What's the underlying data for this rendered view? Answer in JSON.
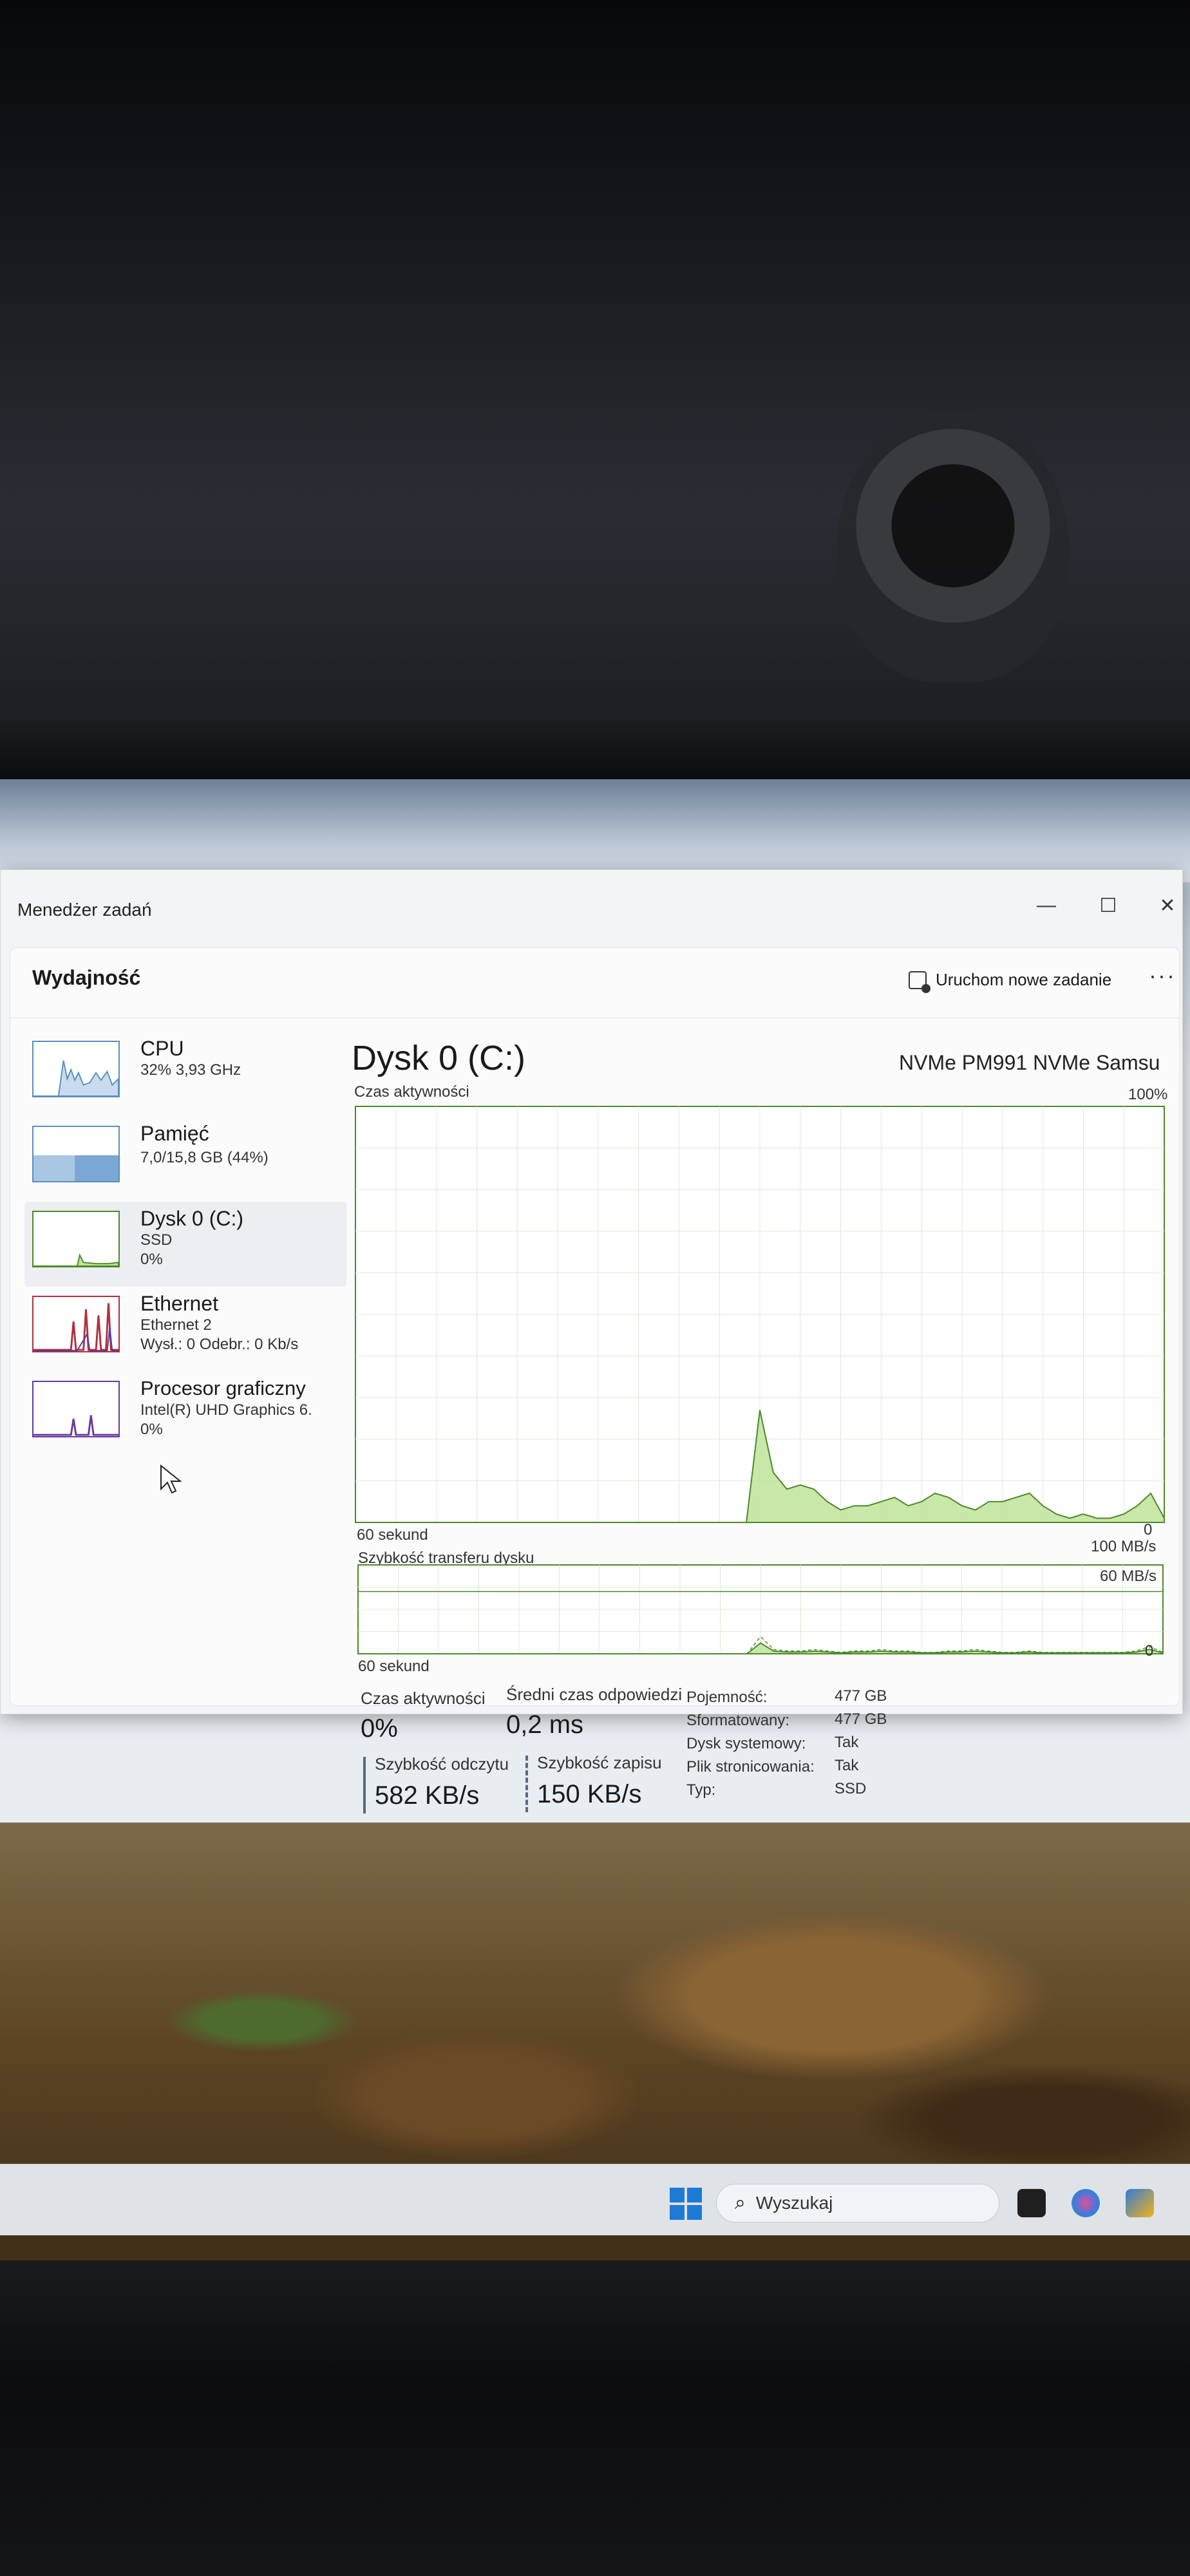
{
  "window": {
    "title": "Menedżer zadań",
    "controls": {
      "minimize": "—",
      "maximize": "☐",
      "close": "✕"
    }
  },
  "header": {
    "page": "Wydajność",
    "run_task_label": "Uruchom nowe zadanie",
    "more_label": "···"
  },
  "sidebar": {
    "items": [
      {
        "name": "CPU",
        "sub1": "32% 3,93 GHz",
        "sub2": "",
        "thumb_color": "#5a8fbf"
      },
      {
        "name": "Pamięć",
        "sub1": "7,0/15,8 GB (44%)",
        "sub2": "",
        "thumb_color": "#5a8fbf"
      },
      {
        "name": "Dysk 0 (C:)",
        "sub1": "SSD",
        "sub2": "0%",
        "thumb_color": "#4a8a2a"
      },
      {
        "name": "Ethernet",
        "sub1": "Ethernet 2",
        "sub2": "Wysł.: 0 Odebr.: 0 Kb/s",
        "thumb_color": "#b03040"
      },
      {
        "name": "Procesor graficzny",
        "sub1": "Intel(R) UHD Graphics 6.",
        "sub2": "0%",
        "thumb_color": "#6a3aa0"
      }
    ]
  },
  "disk": {
    "title": "Dysk 0 (C:)",
    "model": "NVMe PM991 NVMe Samsu",
    "activity_label": "Czas aktywności",
    "activity_max": "100%",
    "time_label_1": "60 sekund",
    "activity_min": "0",
    "transfer_label": "Szybkość transferu dysku",
    "transfer_max": "100 MB/s",
    "transfer_mid": "60 MB/s",
    "time_label_2": "60 sekund",
    "transfer_min": "0"
  },
  "stats": {
    "activity_label": "Czas aktywności",
    "activity_value": "0%",
    "response_label": "Średni czas odpowiedzi",
    "response_value": "0,2 ms",
    "read_label": "Szybkość odczytu",
    "read_value": "582 KB/s",
    "write_label": "Szybkość zapisu",
    "write_value": "150 KB/s"
  },
  "properties": [
    {
      "key": "Pojemność:",
      "value": "477 GB"
    },
    {
      "key": "Sformatowany:",
      "value": "477 GB"
    },
    {
      "key": "Dysk systemowy:",
      "value": "Tak"
    },
    {
      "key": "Plik stronicowania:",
      "value": "Tak"
    },
    {
      "key": "Typ:",
      "value": "SSD"
    }
  ],
  "taskbar": {
    "search_placeholder": "Wyszukaj"
  },
  "colors": {
    "accent_green": "#4a8a2a",
    "green_fill": "#bfe39a",
    "cpu_blue": "#5a8fbf",
    "ethernet_red": "#b03040",
    "gpu_purple": "#6a3aa0"
  },
  "chart_data": [
    {
      "type": "area",
      "title": "Czas aktywności",
      "ylabel": "",
      "ylim": [
        0,
        100
      ],
      "y_unit": "%",
      "x_span_seconds": 60,
      "series": [
        {
          "values": [
            0,
            0,
            0,
            0,
            0,
            0,
            0,
            0,
            0,
            0,
            0,
            0,
            0,
            0,
            0,
            0,
            0,
            0,
            0,
            0,
            0,
            0,
            0,
            0,
            0,
            0,
            0,
            0,
            0,
            0,
            27,
            12,
            8,
            9,
            8,
            5,
            3,
            4,
            4,
            5,
            6,
            4,
            5,
            7,
            6,
            4,
            3,
            5,
            5,
            6,
            7,
            4,
            2,
            1,
            2,
            1,
            1,
            2,
            4,
            7,
            1
          ]
        }
      ]
    },
    {
      "type": "area",
      "title": "Szybkość transferu dysku",
      "ylabel": "",
      "ylim": [
        0,
        100
      ],
      "y_unit": "MB/s",
      "x_span_seconds": 60,
      "series": [
        {
          "values": [
            0,
            0,
            0,
            0,
            0,
            0,
            0,
            0,
            0,
            0,
            0,
            0,
            0,
            0,
            0,
            0,
            0,
            0,
            0,
            0,
            0,
            0,
            0,
            0,
            0,
            0,
            0,
            0,
            0,
            0,
            12,
            3,
            2,
            2,
            3,
            2,
            1,
            2,
            2,
            3,
            2,
            2,
            1,
            1,
            2,
            2,
            3,
            2,
            1,
            1,
            2,
            1,
            1,
            1,
            1,
            1,
            1,
            1,
            2,
            5,
            1
          ]
        }
      ]
    }
  ]
}
